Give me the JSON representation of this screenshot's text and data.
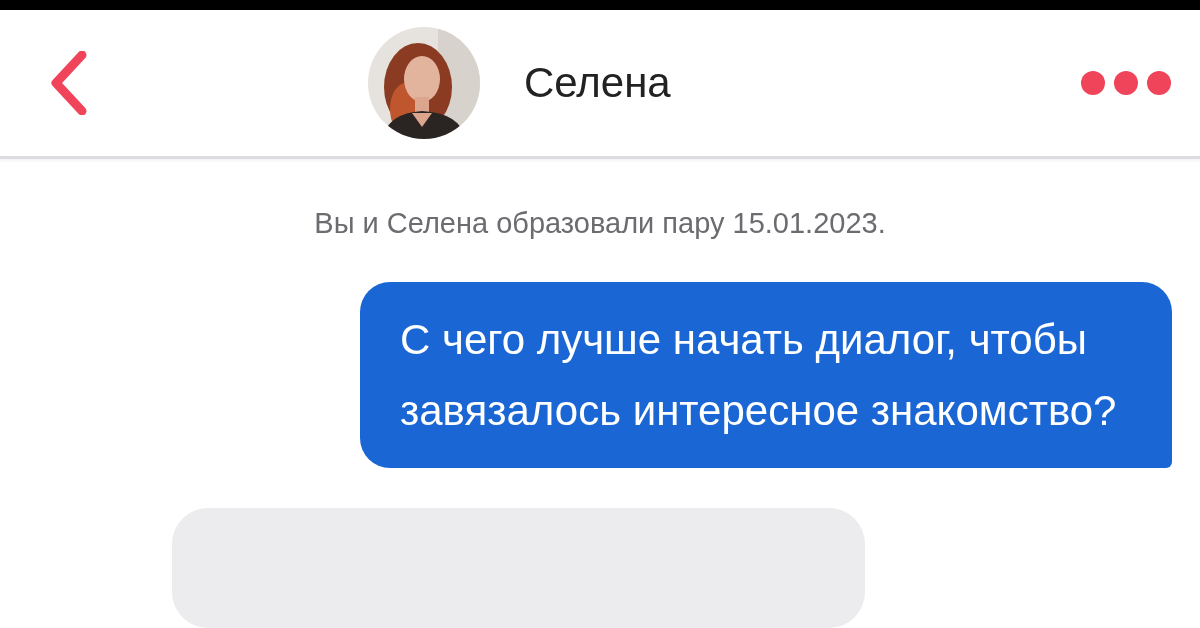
{
  "header": {
    "contact_name": "Селена"
  },
  "system_notice": "Вы и Селена образовали пару 15.01.2023.",
  "messages": [
    {
      "kind": "outgoing",
      "text": "С чего лучше начать диалог, чтобы завязалось интересное знакомство?"
    },
    {
      "kind": "incoming"
    }
  ]
}
